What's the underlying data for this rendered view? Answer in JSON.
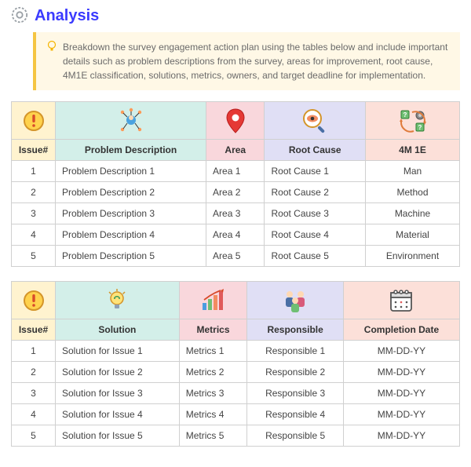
{
  "header": {
    "title": "Analysis"
  },
  "callout": {
    "text": "Breakdown the survey engagement action plan using the tables below and include important details such as problem descriptions from the survey, areas for improvement, root cause, 4M1E classification, solutions, metrics, owners, and target deadline for implementation."
  },
  "table1": {
    "headers": {
      "issue": "Issue#",
      "problem": "Problem Description",
      "area": "Area",
      "root": "Root Cause",
      "fourm": "4M 1E"
    },
    "rows": [
      {
        "issue": "1",
        "problem": "Problem Description 1",
        "area": "Area 1",
        "root": "Root Cause 1",
        "fourm": "Man"
      },
      {
        "issue": "2",
        "problem": "Problem Description 2",
        "area": "Area 2",
        "root": "Root Cause 2",
        "fourm": "Method"
      },
      {
        "issue": "3",
        "problem": "Problem Description 3",
        "area": "Area 3",
        "root": "Root Cause 3",
        "fourm": "Machine"
      },
      {
        "issue": "4",
        "problem": "Problem Description 4",
        "area": "Area 4",
        "root": "Root Cause 4",
        "fourm": "Material"
      },
      {
        "issue": "5",
        "problem": "Problem Description 5",
        "area": "Area 5",
        "root": "Root Cause 5",
        "fourm": "Environment"
      }
    ]
  },
  "table2": {
    "headers": {
      "issue": "Issue#",
      "solution": "Solution",
      "metrics": "Metrics",
      "responsible": "Responsible",
      "completion": "Completion Date"
    },
    "rows": [
      {
        "issue": "1",
        "solution": "Solution for Issue 1",
        "metrics": "Metrics 1",
        "responsible": "Responsible 1",
        "completion": "MM-DD-YY"
      },
      {
        "issue": "2",
        "solution": "Solution for Issue 2",
        "metrics": "Metrics 2",
        "responsible": "Responsible 2",
        "completion": "MM-DD-YY"
      },
      {
        "issue": "3",
        "solution": "Solution for Issue 3",
        "metrics": "Metrics 3",
        "responsible": "Responsible 3",
        "completion": "MM-DD-YY"
      },
      {
        "issue": "4",
        "solution": "Solution for Issue 4",
        "metrics": "Metrics 4",
        "responsible": "Responsible 4",
        "completion": "MM-DD-YY"
      },
      {
        "issue": "5",
        "solution": "Solution for Issue 5",
        "metrics": "Metrics 5",
        "responsible": "Responsible 5",
        "completion": "MM-DD-YY"
      }
    ]
  }
}
